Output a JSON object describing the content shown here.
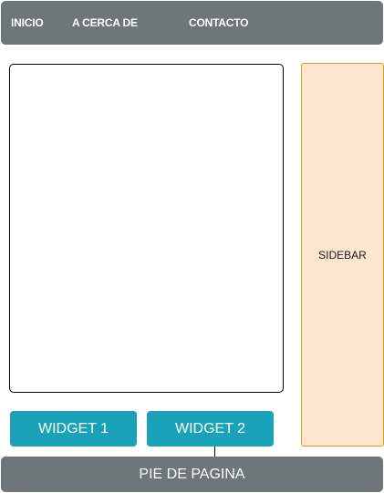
{
  "navbar": {
    "items": [
      {
        "label": "INICIO"
      },
      {
        "label": "A CERCA DE"
      },
      {
        "label": "CONTACTO"
      }
    ]
  },
  "sidebar": {
    "label": "SIDEBAR"
  },
  "widgets": [
    {
      "label": "WIDGET 1"
    },
    {
      "label": "WIDGET 2"
    }
  ],
  "footer": {
    "label": "PIE DE PAGINA"
  },
  "colors": {
    "navbar_bg": "#6d767b",
    "sidebar_bg": "#fce6cf",
    "sidebar_border": "#d7a018",
    "widget_bg": "#1aa3b8",
    "footer_bg": "#6d767b"
  }
}
